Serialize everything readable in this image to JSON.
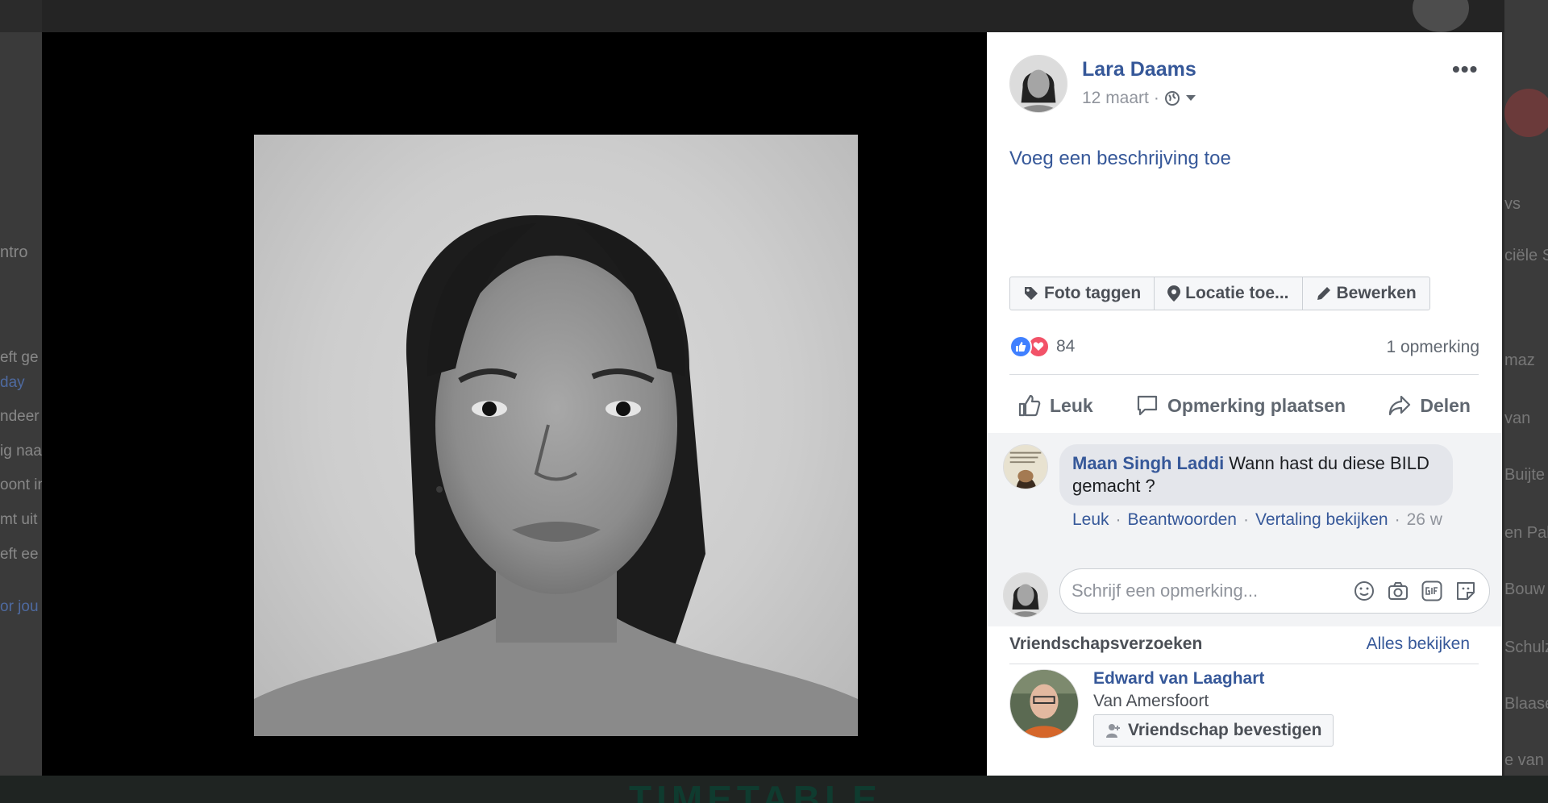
{
  "background": {
    "left_texts": [
      {
        "text": "ntro",
        "link": false
      },
      {
        "text": "eft ge",
        "link": false
      },
      {
        "text": "day",
        "link": true
      },
      {
        "text": "ndeer",
        "link": false
      },
      {
        "text": "ig naa",
        "link": false
      },
      {
        "text": "oont in",
        "link": false
      },
      {
        "text": "mt uit",
        "link": false
      },
      {
        "text": "eft ee",
        "link": false
      },
      {
        "text": "or jou",
        "link": true
      }
    ],
    "right_texts": [
      "vs",
      "ciële S",
      "maz",
      "van",
      "Buijte",
      "en Pal",
      "Bouw",
      "Schulz",
      "Blaase",
      "e van"
    ],
    "banner_text": "TIMETABLE"
  },
  "post": {
    "author": "Lara Daams",
    "date": "12 maart",
    "separator": "·",
    "privacy_icon": "globe-icon",
    "more_icon": "ellipsis-icon",
    "description_link": "Voeg een beschrijving toe"
  },
  "photo_actions": [
    {
      "label": "Foto taggen",
      "icon": "tag-icon"
    },
    {
      "label": "Locatie toe...",
      "icon": "location-pin-icon"
    },
    {
      "label": "Bewerken",
      "icon": "pencil-icon"
    }
  ],
  "reactions": {
    "count": "84",
    "types": [
      "like",
      "love"
    ],
    "comment_count": "1 opmerking"
  },
  "social_actions": [
    {
      "label": "Leuk",
      "icon": "thumbs-up-icon"
    },
    {
      "label": "Opmerking plaatsen",
      "icon": "comment-icon"
    },
    {
      "label": "Delen",
      "icon": "share-icon"
    }
  ],
  "comment": {
    "author": "Maan Singh Laddi",
    "text": "Wann hast du diese BILD gemacht ?",
    "actions": [
      "Leuk",
      "Beantwoorden",
      "Vertaling bekijken"
    ],
    "dot": "·",
    "time": "26 w"
  },
  "write_comment": {
    "placeholder": "Schrijf een opmerking...",
    "icons": [
      "emoji-icon",
      "camera-icon",
      "gif-icon",
      "sticker-icon"
    ]
  },
  "friend_requests": {
    "header": "Vriendschapsverzoeken",
    "see_all": "Alles bekijken",
    "friend": {
      "name": "Edward van Laaghart",
      "location": "Van Amersfoort",
      "confirm_label": "Vriendschap bevestigen"
    }
  },
  "colors": {
    "link": "#365899",
    "like": "#4080ff",
    "love": "#f25268",
    "stage": "#000000"
  }
}
